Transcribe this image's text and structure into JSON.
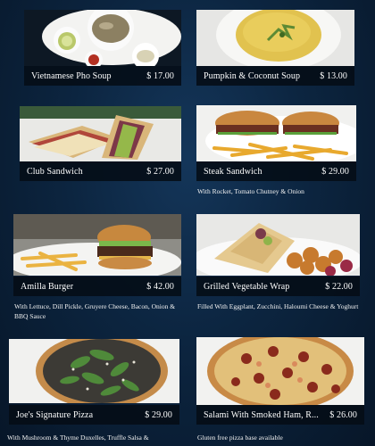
{
  "menu": {
    "items": [
      {
        "name": "Vietnamese Pho Soup",
        "price": "$ 17.00",
        "description": ""
      },
      {
        "name": "Pumpkin & Coconut Soup",
        "price": "$ 13.00",
        "description": ""
      },
      {
        "name": "Club Sandwich",
        "price": "$ 27.00",
        "description": ""
      },
      {
        "name": "Steak Sandwich",
        "price": "$ 29.00",
        "description": "With Rocket, Tomato Chutney & Onion"
      },
      {
        "name": "Amilla Burger",
        "price": "$ 42.00",
        "description": "With Lettuce, Dill Pickle, Gruyere Cheese, Bacon, Onion & BBQ Sauce"
      },
      {
        "name": "Grilled Vegetable Wrap",
        "price": "$ 22.00",
        "description": "Filled With Eggplant, Zucchini, Haloumi Cheese & Yoghurt"
      },
      {
        "name": "Joe's Signature Pizza",
        "price": "$ 29.00",
        "description": "With Mushroom & Thyme Duxelles, Truffle Salsa &"
      },
      {
        "name": "Salami With Smoked Ham, R...",
        "price": "$ 26.00",
        "description": "Gluten free pizza base available"
      }
    ]
  },
  "colors": {
    "background": "#0a1e33",
    "namebar": "#050c16",
    "text": "#ffffff"
  }
}
